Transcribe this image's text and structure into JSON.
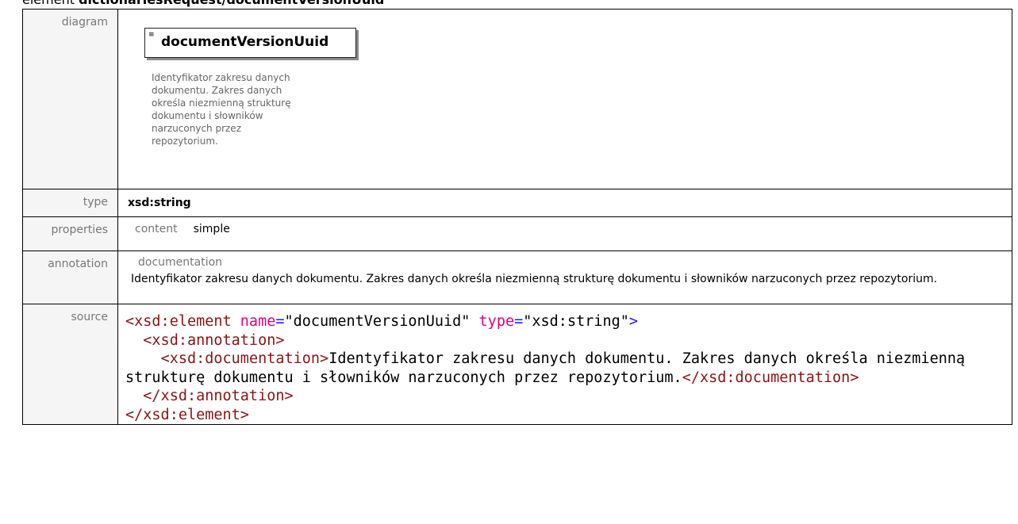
{
  "heading": {
    "prefix": "element",
    "path": "dictionariesRequest/documentVersionUuid"
  },
  "labels": {
    "diagram": "diagram",
    "type": "type",
    "properties": "properties",
    "annotation": "annotation",
    "source": "source"
  },
  "diagram": {
    "element_name": "documentVersionUuid",
    "element_icon": "lines-icon",
    "doc_text": "Identyfikator zakresu danych dokumentu. Zakres danych określa niezmienną strukturę dokumentu i słowników narzuconych przez repozytorium."
  },
  "type": {
    "value": "xsd:string"
  },
  "properties": {
    "key": "content",
    "value": "simple"
  },
  "annotation": {
    "key": "documentation",
    "text": "Identyfikator zakresu danych dokumentu. Zakres danych określa niezmienną strukturę dokumentu i słowników narzuconych przez repozytorium."
  },
  "source": {
    "open_tag": "<xsd:element",
    "attr1_name": "name",
    "attr1_value": "\"documentVersionUuid\"",
    "attr2_name": "type",
    "attr2_value": "\"xsd:string\"",
    "open_end": ">",
    "annotation_open": "<xsd:annotation>",
    "documentation_open": "<xsd:documentation>",
    "documentation_text": "Identyfikator zakresu danych dokumentu. Zakres danych określa niezmienną strukturę dokumentu i słowników narzuconych przez repozytorium.",
    "documentation_close": "</xsd:documentation>",
    "annotation_close": "</xsd:annotation>",
    "element_close": "</xsd:element>"
  },
  "colors": {
    "tag": "#8b1414",
    "attr_name": "#e0007f",
    "punct": "#1a1aff",
    "label": "#777777"
  }
}
